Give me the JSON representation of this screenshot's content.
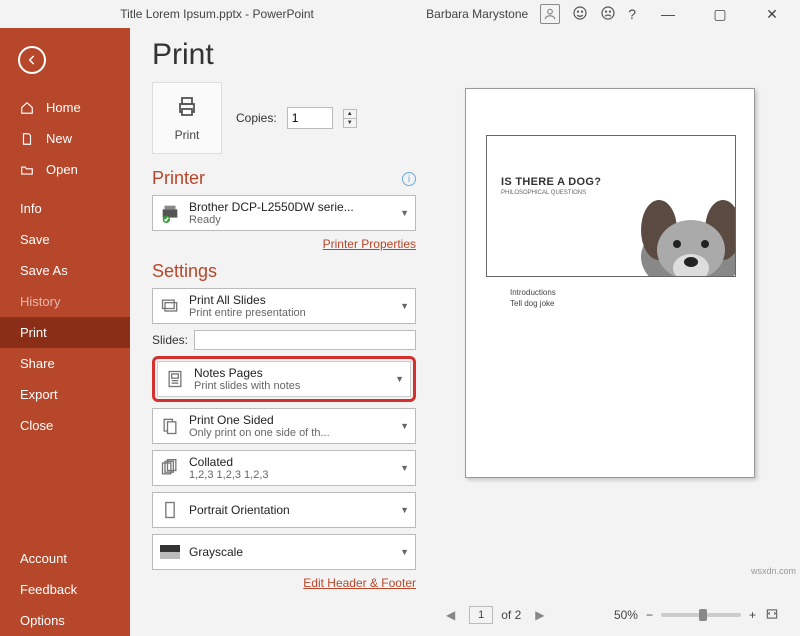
{
  "titlebar": {
    "title": "Title Lorem Ipsum.pptx  -  PowerPoint",
    "user": "Barbara Marystone"
  },
  "sidebar": {
    "home": "Home",
    "new": "New",
    "open": "Open",
    "info": "Info",
    "save": "Save",
    "saveas": "Save As",
    "history": "History",
    "print": "Print",
    "share": "Share",
    "export": "Export",
    "close": "Close",
    "account": "Account",
    "feedback": "Feedback",
    "options": "Options"
  },
  "page": {
    "title": "Print",
    "print_label": "Print",
    "copies_label": "Copies:",
    "copies_value": "1",
    "printer_heading": "Printer",
    "printer_name": "Brother DCP-L2550DW serie...",
    "printer_status": "Ready",
    "printer_props": "Printer Properties",
    "settings_heading": "Settings",
    "slides_label": "Slides:",
    "edit_hf": "Edit Header & Footer",
    "dd_all": {
      "t1": "Print All Slides",
      "t2": "Print entire presentation"
    },
    "dd_notes": {
      "t1": "Notes Pages",
      "t2": "Print slides with notes"
    },
    "dd_sided": {
      "t1": "Print One Sided",
      "t2": "Only print on one side of th..."
    },
    "dd_collated": {
      "t1": "Collated",
      "t2": "1,2,3    1,2,3    1,2,3"
    },
    "dd_orient": {
      "t1": "Portrait Orientation",
      "t2": ""
    },
    "dd_color": {
      "t1": "Grayscale",
      "t2": ""
    }
  },
  "preview": {
    "headline": "IS THERE A DOG?",
    "sub": "PHILOSOPHICAL QUESTIONS",
    "note1": "Introductions",
    "note2": "Tell  dog joke"
  },
  "status": {
    "page": "1",
    "of": "of 2",
    "zoom": "50%"
  },
  "watermark": "wsxdn.com"
}
